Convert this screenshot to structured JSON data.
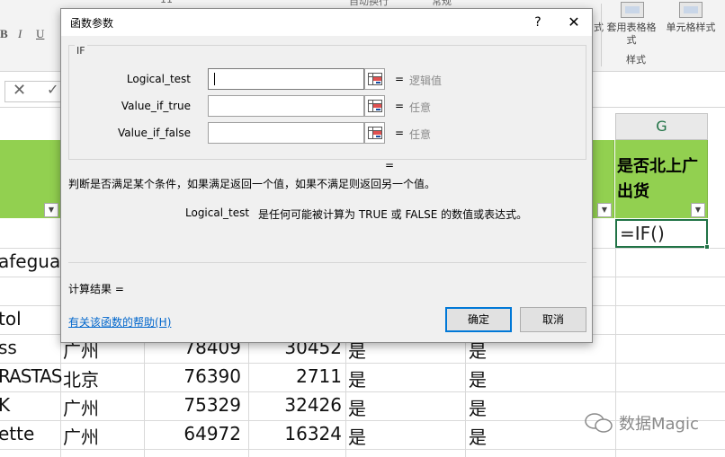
{
  "ribbon": {
    "top_fragments": [
      "11",
      "自动换行",
      "常规"
    ],
    "font_format": [
      "B",
      "I",
      "U"
    ],
    "table_format_label": "套用表格格式",
    "cell_style_label": "单元格样式",
    "style_group_label": "样式",
    "partial_left": "式"
  },
  "formula_bar": {
    "cancel_icon": "close-icon",
    "enter_icon": "check-icon"
  },
  "sheet": {
    "col_g": "G",
    "header_g": "是否北上广出货",
    "formula_cell": "=IF()",
    "rows": [
      {
        "a": "afegua",
        "b": "",
        "c": "",
        "d": "",
        "e": "",
        "f": ""
      },
      {
        "a": "",
        "b": "",
        "c": "",
        "d": "",
        "e": "",
        "f": ""
      },
      {
        "a": "tol",
        "b": "",
        "c": "",
        "d": "",
        "e": "",
        "f": ""
      },
      {
        "a": "ss",
        "b": "广州",
        "c": "78409",
        "d": "30452",
        "e": "是",
        "f": "是"
      },
      {
        "a": "RASTAS",
        "b": "北京",
        "c": "76390",
        "d": "2711",
        "e": "是",
        "f": "是"
      },
      {
        "a": "K",
        "b": "广州",
        "c": "75329",
        "d": "32426",
        "e": "是",
        "f": "是"
      },
      {
        "a": "ette",
        "b": "广州",
        "c": "64972",
        "d": "16324",
        "e": "是",
        "f": "是"
      }
    ]
  },
  "watermark": "数据Magic",
  "dialog": {
    "title": "函数参数",
    "help_glyph": "?",
    "close_glyph": "✕",
    "function_name": "IF",
    "args": [
      {
        "label": "Logical_test",
        "value": "",
        "eq": "=",
        "hint": "逻辑值"
      },
      {
        "label": "Value_if_true",
        "value": "",
        "eq": "=",
        "hint": "任意"
      },
      {
        "label": "Value_if_false",
        "value": "",
        "eq": "=",
        "hint": "任意"
      }
    ],
    "result_eq": "=",
    "description": "判断是否满足某个条件，如果满足返回一个值，如果不满足则返回另一个值。",
    "arg_desc_name": "Logical_test",
    "arg_desc_text": "是任何可能被计算为 TRUE 或 FALSE 的数值或表达式。",
    "calc_result": "计算结果 =",
    "help_link": "有关该函数的帮助(H)",
    "ok": "确定",
    "cancel": "取消"
  }
}
